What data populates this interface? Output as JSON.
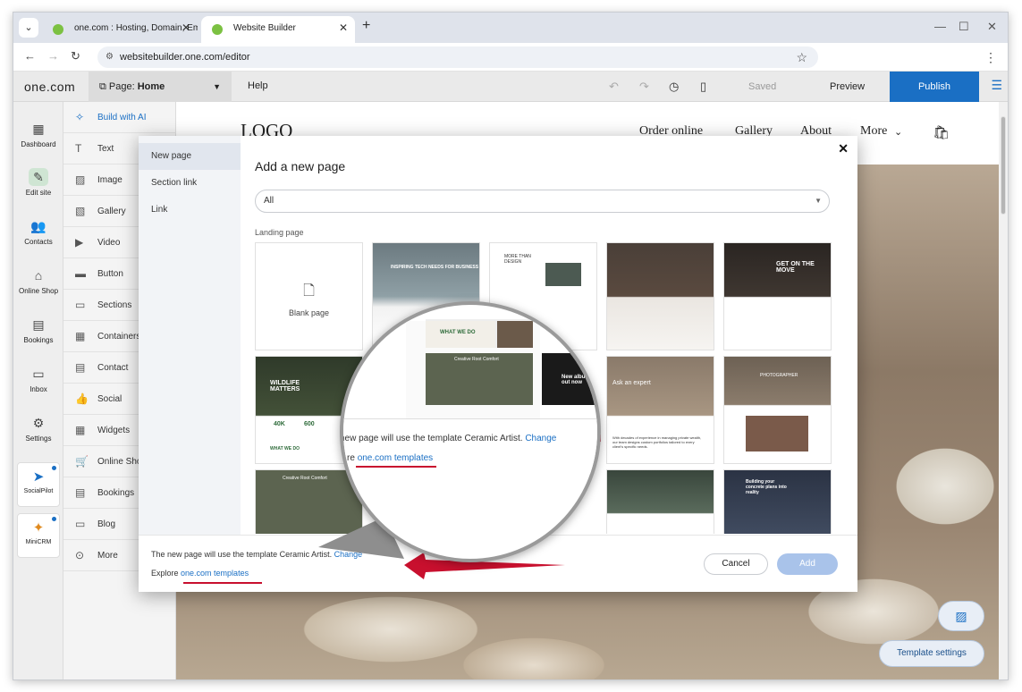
{
  "browser": {
    "tabs": [
      {
        "title": "one.com : Hosting, Domain, Em"
      },
      {
        "title": "Website Builder"
      }
    ],
    "url": "websitebuilder.one.com/editor"
  },
  "app": {
    "brand": "one.com",
    "page_selector": {
      "prefix": "Page:",
      "value": "Home"
    },
    "help": "Help",
    "saved": "Saved",
    "preview": "Preview",
    "publish": "Publish"
  },
  "rail": [
    {
      "label": "Dashboard",
      "icon": "dashboard-icon"
    },
    {
      "label": "Edit site",
      "icon": "edit-site-icon"
    },
    {
      "label": "Contacts",
      "icon": "contacts-icon"
    },
    {
      "label": "Online Shop",
      "icon": "shop-icon"
    },
    {
      "label": "Bookings",
      "icon": "bookings-icon"
    },
    {
      "label": "Inbox",
      "icon": "inbox-icon"
    },
    {
      "label": "Settings",
      "icon": "settings-icon"
    },
    {
      "label": "SocialPilot",
      "icon": "socialpilot-icon"
    },
    {
      "label": "MiniCRM",
      "icon": "minicrm-icon"
    }
  ],
  "tools": [
    {
      "label": "Build with AI",
      "icon": "sparkle-icon"
    },
    {
      "label": "Text",
      "icon": "text-icon"
    },
    {
      "label": "Image",
      "icon": "image-icon"
    },
    {
      "label": "Gallery",
      "icon": "gallery-icon"
    },
    {
      "label": "Video",
      "icon": "video-icon"
    },
    {
      "label": "Button",
      "icon": "button-icon"
    },
    {
      "label": "Sections",
      "icon": "sections-icon"
    },
    {
      "label": "Containers",
      "icon": "containers-icon"
    },
    {
      "label": "Contact",
      "icon": "contact-icon"
    },
    {
      "label": "Social",
      "icon": "social-icon"
    },
    {
      "label": "Widgets",
      "icon": "widgets-icon"
    },
    {
      "label": "Online Shop",
      "icon": "cart-icon"
    },
    {
      "label": "Bookings",
      "icon": "bookings-icon"
    },
    {
      "label": "Blog",
      "icon": "blog-icon"
    },
    {
      "label": "More",
      "icon": "more-icon"
    }
  ],
  "site": {
    "logo": "LOGO",
    "nav": [
      "Order online",
      "Gallery",
      "About",
      "More"
    ]
  },
  "canvas_buttons": {
    "template_settings": "Template settings"
  },
  "modal": {
    "side": [
      "New page",
      "Section link",
      "Link"
    ],
    "title": "Add a new page",
    "filter": "All",
    "section_label": "Landing page",
    "blank_label": "Blank page",
    "template_texts": {
      "t1": "INSPIRING TECH NEEDS FOR BUSINESS",
      "t2": "MORE THAN DESIGN",
      "t4": "GET ON THE MOVE",
      "t5": "WILDLIFE MATTERS",
      "t5a": "40K",
      "t5b": "600",
      "t5c": "WHAT WE DO",
      "t6": "Ask an expert",
      "t6b": "With decades of experience in managing private wealth, our team designs custom portfolios tailored to every client's specific needs.",
      "t7": "PHOTOGRAPHER",
      "t9": "Creative Root Comfort",
      "t12": "Building your concrete plans into reality"
    },
    "footer": {
      "message": "The new page will use the template Ceramic Artist.",
      "change": "Change",
      "explore": "Explore",
      "templates_link": "one.com templates",
      "cancel": "Cancel",
      "add": "Add"
    }
  },
  "magnifier": {
    "what_we_do": "WHAT WE DO",
    "creative": "Creative Root Comfort",
    "new_album": "New album out now",
    "message": "new page will use the template Ceramic Artist.",
    "change": "Change",
    "explore_prefix": "re",
    "templates_link": "one.com templates"
  },
  "colors": {
    "accent": "#1a6fc4",
    "arrow_red": "#c8102e"
  }
}
